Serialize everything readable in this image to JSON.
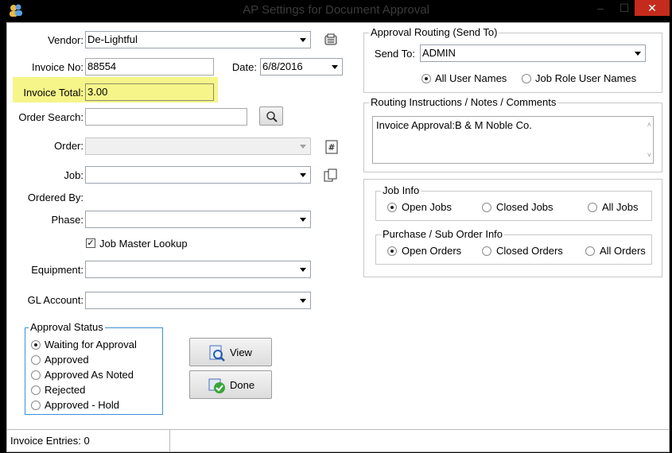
{
  "window": {
    "title": "AP Settings for Document Approval",
    "minimize": "–",
    "maximize": "☐",
    "close": "✕"
  },
  "form": {
    "vendor_label": "Vendor:",
    "vendor_value": "De-Lightful",
    "invoice_no_label": "Invoice No:",
    "invoice_no_value": "88554",
    "date_label": "Date:",
    "date_value": "6/8/2016",
    "invoice_total_label": "Invoice Total:",
    "invoice_total_value": "3.00",
    "order_search_label": "Order Search:",
    "order_search_value": "",
    "order_label": "Order:",
    "job_label": "Job:",
    "ordered_by_label": "Ordered By:",
    "phase_label": "Phase:",
    "job_master_lookup_label": "Job Master Lookup",
    "job_master_lookup_checked": true,
    "equipment_label": "Equipment:",
    "gl_account_label": "GL Account:"
  },
  "approval_status": {
    "title": "Approval Status",
    "options": [
      "Waiting for Approval",
      "Approved",
      "Approved As Noted",
      "Rejected",
      "Approved - Hold"
    ],
    "selected": "Waiting for Approval"
  },
  "buttons": {
    "view": "View",
    "done": "Done"
  },
  "routing": {
    "title": "Approval Routing (Send To)",
    "send_to_label": "Send To:",
    "send_to_value": "ADMIN",
    "all_user_names": "All User Names",
    "job_role_user_names": "Job Role User Names",
    "selected": "All User Names"
  },
  "instructions": {
    "title": "Routing Instructions / Notes / Comments",
    "text": "Invoice Approval:B & M Noble Co."
  },
  "job_info": {
    "title": "Job Info",
    "open": "Open Jobs",
    "closed": "Closed Jobs",
    "all": "All Jobs",
    "selected": "Open Jobs"
  },
  "order_info": {
    "title": "Purchase / Sub Order Info",
    "open": "Open Orders",
    "closed": "Closed Orders",
    "all": "All Orders",
    "selected": "Open Orders"
  },
  "status_bar": {
    "invoice_entries": "Invoice Entries: 0"
  },
  "colors": {
    "highlight": "#f6f58a",
    "close_button": "#c42b1c"
  }
}
